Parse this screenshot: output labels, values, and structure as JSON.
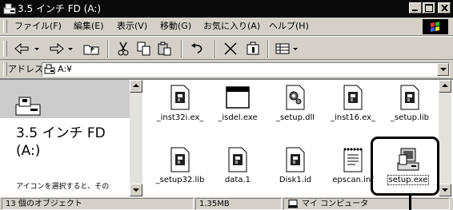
{
  "window": {
    "title": "3.5 インチ FD (A:)"
  },
  "menu": [
    {
      "label": "ファイル(F)"
    },
    {
      "label": "編集(E)"
    },
    {
      "label": "表示(V)"
    },
    {
      "label": "移動(G)"
    },
    {
      "label": "お気に入り(A)"
    },
    {
      "label": "ヘルプ(H)"
    }
  ],
  "toolbar": {
    "icons": [
      "back-icon",
      "forward-icon",
      "up-folder-icon",
      "cut-icon",
      "copy-icon",
      "paste-icon",
      "undo-icon",
      "delete-icon",
      "properties-icon",
      "views-icon"
    ]
  },
  "address": {
    "label": "アドレス",
    "value": "A:¥"
  },
  "left_pane": {
    "drive_name_line1": "3.5 インチ FD",
    "drive_name_line2": "(A:)",
    "hint": "アイコンを選択すると、その"
  },
  "files": [
    {
      "name": "_inst32i.ex_",
      "icon": "setup-file-icon"
    },
    {
      "name": "_isdel.exe",
      "icon": "window-app-icon"
    },
    {
      "name": "_setup.dll",
      "icon": "dll-gear-icon"
    },
    {
      "name": "_inst16.ex_",
      "icon": "setup-file-icon"
    },
    {
      "name": "_setup.lib",
      "icon": "setup-file-icon"
    },
    {
      "name": "_setup32.lib",
      "icon": "setup-file-icon"
    },
    {
      "name": "data.1",
      "icon": "setup-file-icon"
    },
    {
      "name": "Disk1.id",
      "icon": "setup-file-icon"
    },
    {
      "name": "epscan.inf",
      "icon": "inf-notepad-icon"
    },
    {
      "name": "setup.exe",
      "icon": "installer-computer-icon",
      "selected": true
    }
  ],
  "status": {
    "objects": "13 個のオブジェクト",
    "size": "1.35MB",
    "location": "マイ コンピュータ"
  },
  "colors": {
    "titlebar": "#0a0a0a",
    "chrome": "#d4d0c8",
    "pane_header": "#cccccc"
  }
}
